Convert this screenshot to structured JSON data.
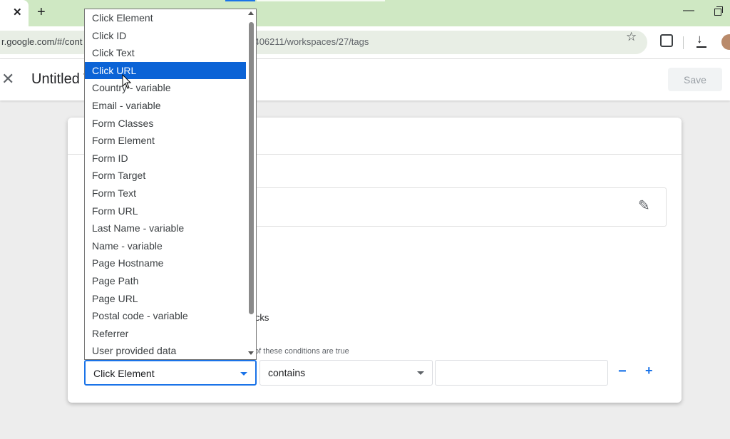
{
  "browser": {
    "tab_close": "✕",
    "new_tab": "+",
    "url_left": "r.google.com/#/cont",
    "url_right": "22406211/workspaces/27/tags",
    "minimize": "—"
  },
  "header": {
    "close": "✕",
    "title": "Untitled T",
    "save_label": "Save"
  },
  "card": {
    "clicks_text": "icks",
    "conditions_text": "of these conditions are true",
    "variable_select_value": "Click Element",
    "operator_select_value": "contains",
    "value_input": "",
    "minus_label": "−",
    "plus_label": "+"
  },
  "dropdown": {
    "options": [
      "Click Element",
      "Click ID",
      "Click Text",
      "Click URL",
      "Country - variable",
      "Email - variable",
      "Form Classes",
      "Form Element",
      "Form ID",
      "Form Target",
      "Form Text",
      "Form URL",
      "Last Name - variable",
      "Name - variable",
      "Page Hostname",
      "Page Path",
      "Page URL",
      "Postal code - variable",
      "Referrer",
      "User provided data"
    ],
    "highlighted": "Click URL"
  },
  "colors": {
    "accent": "#1a73e8",
    "highlight": "#0b63d6",
    "tabstrip": "#cfe8c3"
  }
}
